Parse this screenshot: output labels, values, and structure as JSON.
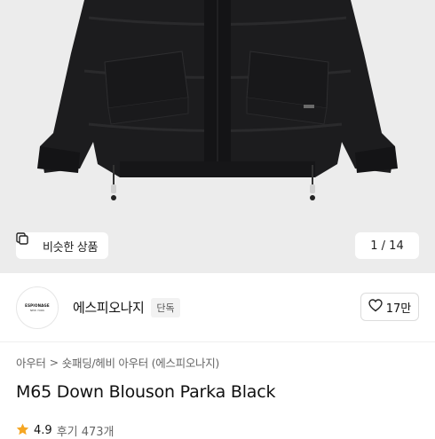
{
  "hero": {
    "image_alt": "black down blouson parka",
    "similar_label": "비슷한 상품",
    "counter": "1 / 14"
  },
  "store": {
    "logo_line1": "ESPIONAGE",
    "logo_line2": "NEW YORK",
    "name": "에스피오나지",
    "badge": "단독",
    "like_count": "17만"
  },
  "breadcrumb": {
    "level1": "아우터",
    "separator": ">",
    "level2": "숏패딩/헤비 아우터 (에스피오나지)"
  },
  "product": {
    "title": "M65 Down Blouson Parka Black"
  },
  "rating": {
    "score": "4.9",
    "reviews": "후기 473개"
  },
  "colors": {
    "star": "#f5a623",
    "background_hero": "#ececec"
  },
  "icons": [
    "similar-products-icon",
    "heart-icon",
    "star-icon",
    "chevron-right-icon"
  ]
}
